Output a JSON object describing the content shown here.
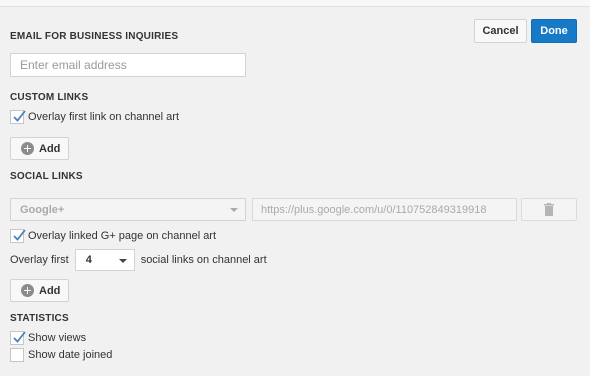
{
  "toolbar": {
    "cancel_label": "Cancel",
    "done_label": "Done"
  },
  "email": {
    "heading": "EMAIL FOR BUSINESS INQUIRIES",
    "placeholder": "Enter email address"
  },
  "custom_links": {
    "heading": "CUSTOM LINKS",
    "overlay_label": "Overlay first link on channel art",
    "overlay_checked": true,
    "add_label": "Add"
  },
  "social_links": {
    "heading": "SOCIAL LINKS",
    "network_selected": "Google+",
    "url_value": "https://plus.google.com/u/0/110752849319918",
    "overlay_gplus_label": "Overlay linked G+ page on channel art",
    "overlay_gplus_checked": true,
    "overlay_first_prefix": "Overlay first",
    "overlay_first_count": "4",
    "overlay_first_suffix": "social links on channel art",
    "add_label": "Add"
  },
  "statistics": {
    "heading": "STATISTICS",
    "show_views_label": "Show views",
    "show_views_checked": true,
    "show_date_label": "Show date joined",
    "show_date_checked": false
  },
  "colors": {
    "primary": "#167ac6",
    "background": "#f1f1f1",
    "check": "#4a7fc0"
  },
  "icons": [
    "plus-circle-icon",
    "trash-icon",
    "checkmark-icon",
    "caret-down-icon"
  ]
}
